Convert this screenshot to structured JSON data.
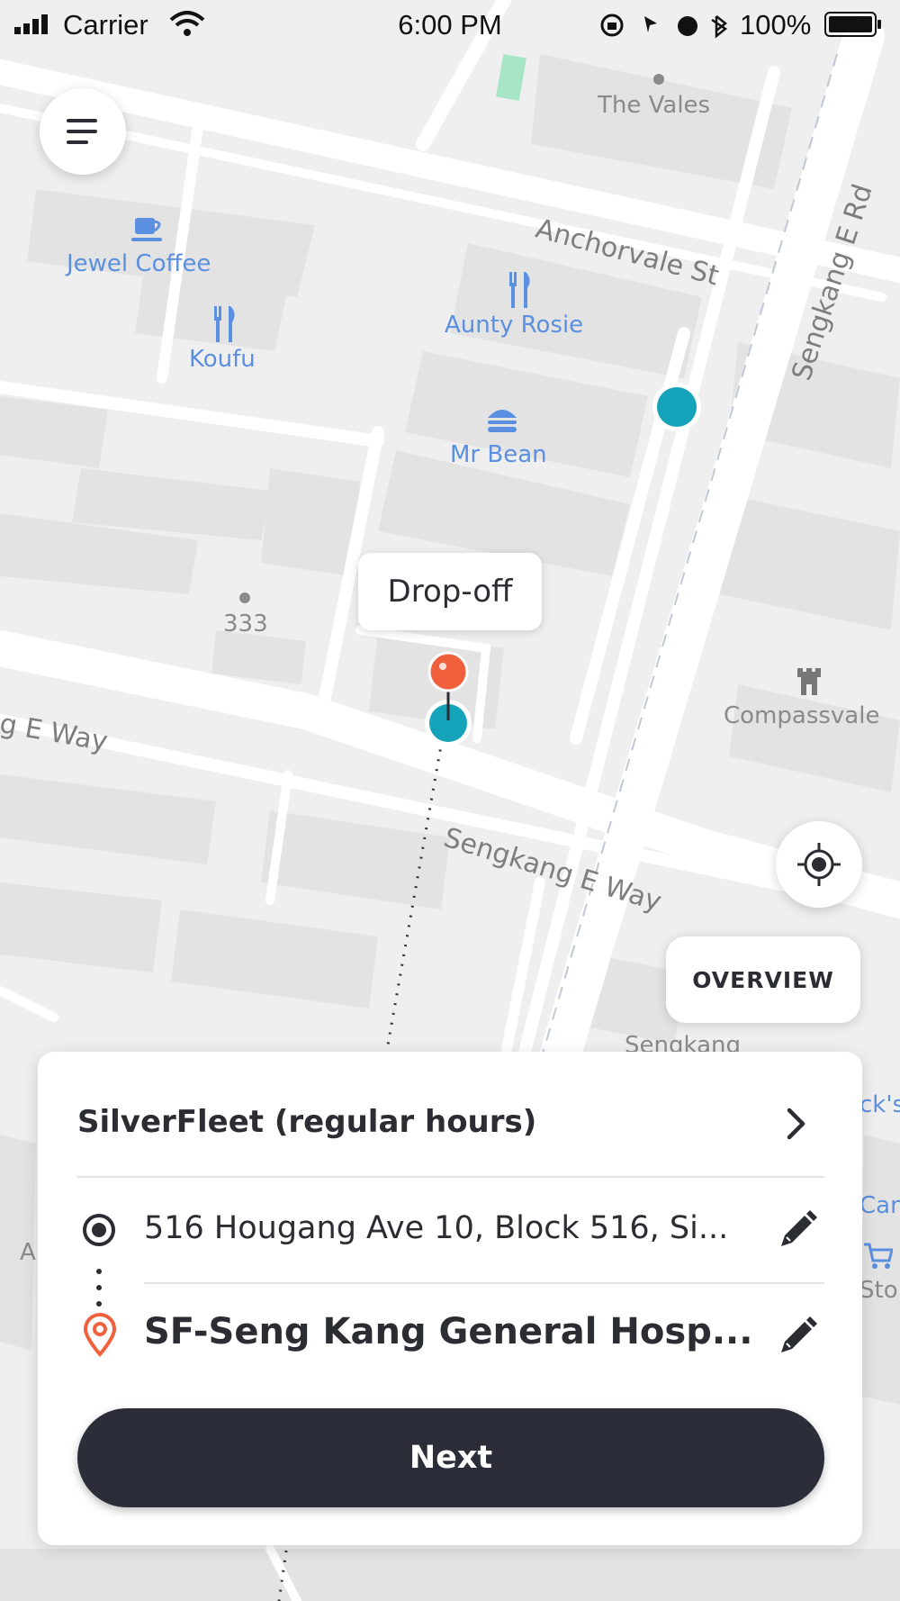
{
  "status_bar": {
    "carrier": "Carrier",
    "time": "6:00 PM",
    "battery": "100%"
  },
  "map": {
    "pois": {
      "the_vales": "The Vales",
      "jewel_coffee": "Jewel Coffee",
      "koufu": "Koufu",
      "aunty_rosie": "Aunty Rosie",
      "mr_bean": "Mr Bean",
      "block_333": "333",
      "compassvale": "Compassvale",
      "sengkang_partial": "Sengkang",
      "cks_partial": "ck's",
      "can_partial": "Can",
      "sto_partial": "Sto",
      "a_partial": "A"
    },
    "roads": {
      "anchorvale_st": "Anchorvale St",
      "sengkang_e_rd": "Sengkang E Rd",
      "sengkang_e_way": "Sengkang E Way",
      "g_e_way_partial": "g E Way"
    },
    "dropoff_label": "Drop-off",
    "overview_label": "OVERVIEW",
    "colors": {
      "pickup_dot": "#14a3b8",
      "dropoff_pin": "#f0603c",
      "poi_text": "#5b8fe0"
    }
  },
  "booking_card": {
    "service": "SilverFleet (regular hours)",
    "pickup_address": "516 Hougang Ave 10, Block 516, Si...",
    "dropoff_address": "SF-Seng Kang General Hosp...",
    "next_label": "Next"
  },
  "icons": [
    "menu-icon",
    "locate-icon",
    "chevron-right-icon",
    "pickup-target-icon",
    "dropoff-pin-icon",
    "edit-pencil-icon",
    "coffee-icon",
    "fork-knife-icon",
    "burger-icon",
    "castle-icon",
    "cart-icon",
    "signal-icon",
    "wifi-icon",
    "battery-icon"
  ]
}
